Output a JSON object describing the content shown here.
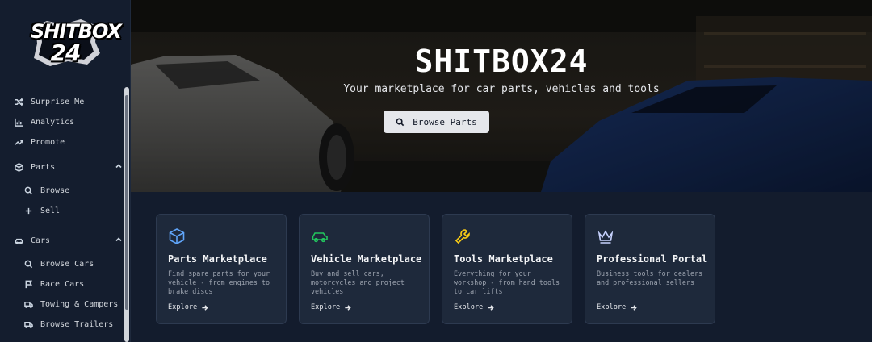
{
  "brand": {
    "logo_line1": "SHITBOX",
    "logo_line2": "24"
  },
  "sidebar": {
    "items": [
      {
        "label": "Surprise Me",
        "icon": "shuffle-icon"
      },
      {
        "label": "Analytics",
        "icon": "bar-chart-icon"
      },
      {
        "label": "Promote",
        "icon": "trending-up-icon"
      },
      {
        "label": "Parts",
        "icon": "box-icon",
        "expanded": true
      },
      {
        "label": "Browse",
        "icon": "search-icon"
      },
      {
        "label": "Sell",
        "icon": "plus-icon"
      },
      {
        "label": "Cars",
        "icon": "car-icon",
        "expanded": true
      },
      {
        "label": "Browse Cars",
        "icon": "search-icon"
      },
      {
        "label": "Race Cars",
        "icon": "flag-icon"
      },
      {
        "label": "Towing & Campers",
        "icon": "truck-icon"
      },
      {
        "label": "Browse Trailers",
        "icon": "trailer-icon"
      }
    ]
  },
  "hero": {
    "title": "SHITBOX24",
    "subtitle": "Your marketplace for car parts, vehicles and tools",
    "button_label": "Browse Parts"
  },
  "cards": [
    {
      "title": "Parts Marketplace",
      "description": "Find spare parts for your vehicle - from engines to brake discs",
      "link": "Explore",
      "icon": "box-icon",
      "color": "#60a5fa"
    },
    {
      "title": "Vehicle Marketplace",
      "description": "Buy and sell cars, motorcycles and project vehicles",
      "link": "Explore",
      "icon": "car-icon",
      "color": "#22c55e"
    },
    {
      "title": "Tools Marketplace",
      "description": "Everything for your workshop - from hand tools to car lifts",
      "link": "Explore",
      "icon": "wrench-icon",
      "color": "#facc15"
    },
    {
      "title": "Professional Portal",
      "description": "Business tools for dealers and professional sellers",
      "link": "Explore",
      "icon": "crown-icon",
      "color": "#c7d2fe"
    }
  ]
}
